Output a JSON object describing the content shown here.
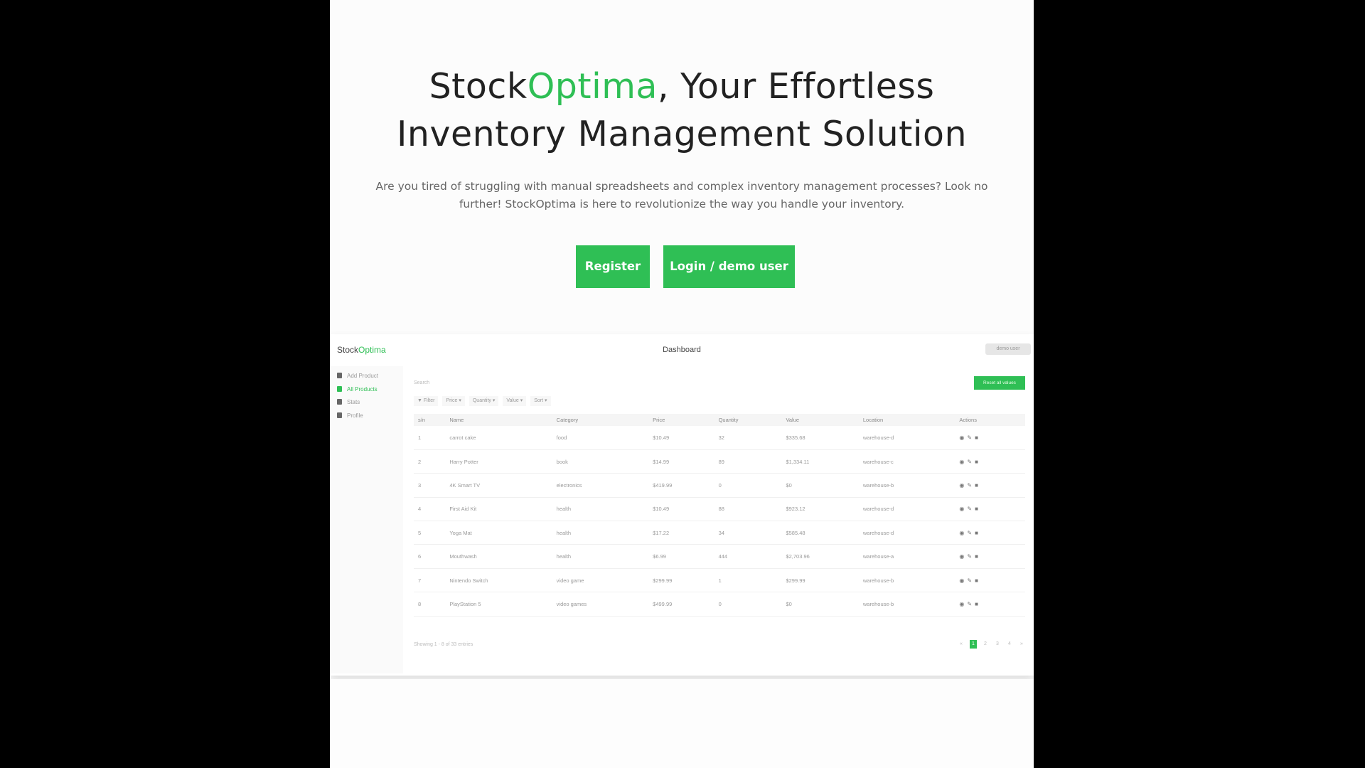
{
  "hero": {
    "title_brand_main": "Stock",
    "title_brand_accent": "Optima",
    "title_rest_line1": ", Your Effortless",
    "title_line2": "Inventory Management Solution",
    "description": "Are you tired of struggling with manual spreadsheets and complex inventory management processes? Look no further! StockOptima is here to revolutionize the way you handle your inventory.",
    "register_label": "Register",
    "login_label": "Login / demo user"
  },
  "preview": {
    "logo_main": "Stock",
    "logo_accent": "Optima",
    "page_title": "Dashboard",
    "user_label": "demo user",
    "sidebar": [
      {
        "label": "Add Product",
        "icon": "file-icon",
        "active": false
      },
      {
        "label": "All Products",
        "icon": "folder-icon",
        "active": true
      },
      {
        "label": "Stats",
        "icon": "bar-chart-icon",
        "active": false
      },
      {
        "label": "Profile",
        "icon": "user-icon",
        "active": false
      }
    ],
    "search_placeholder": "Search",
    "reset_label": "Reset all values",
    "filters": [
      "Filter",
      "Price",
      "Quantity",
      "Value",
      "Sort"
    ],
    "columns": [
      "s/n",
      "Name",
      "Category",
      "Price",
      "Quantity",
      "Value",
      "Location",
      "Actions"
    ],
    "rows": [
      [
        "1",
        "carrot cake",
        "food",
        "$10.49",
        "32",
        "$335.68",
        "warehouse-d"
      ],
      [
        "2",
        "Harry Potter",
        "book",
        "$14.99",
        "89",
        "$1,334.11",
        "warehouse-c"
      ],
      [
        "3",
        "4K Smart TV",
        "electronics",
        "$419.99",
        "0",
        "$0",
        "warehouse-b"
      ],
      [
        "4",
        "First Aid Kit",
        "health",
        "$10.49",
        "88",
        "$923.12",
        "warehouse-d"
      ],
      [
        "5",
        "Yoga Mat",
        "health",
        "$17.22",
        "34",
        "$585.48",
        "warehouse-d"
      ],
      [
        "6",
        "Mouthwash",
        "health",
        "$6.99",
        "444",
        "$2,703.96",
        "warehouse-a"
      ],
      [
        "7",
        "Nintendo Switch",
        "video game",
        "$299.99",
        "1",
        "$299.99",
        "warehouse-b"
      ],
      [
        "8",
        "PlayStation 5",
        "video games",
        "$499.99",
        "0",
        "$0",
        "warehouse-b"
      ]
    ],
    "footer_text": "Showing 1 - 8 of 33 entries",
    "pages": [
      "«",
      "1",
      "2",
      "3",
      "4",
      "»"
    ],
    "active_page": "1"
  },
  "colors": {
    "accent": "#2fbf55",
    "text": "#222222",
    "muted": "#666666"
  }
}
